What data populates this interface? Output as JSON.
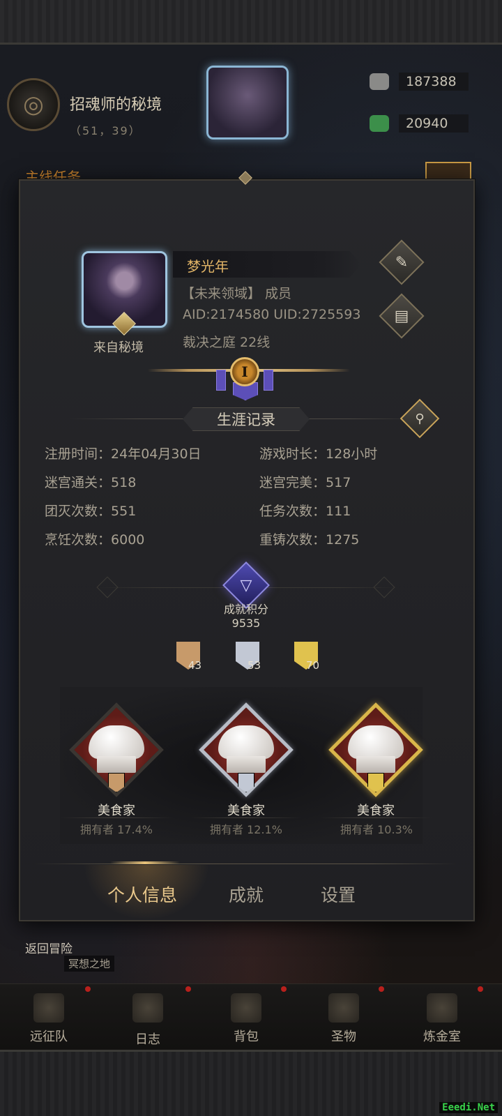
{
  "background": {
    "map_name": "招魂师的秘境",
    "map_coord": "（51，39）",
    "resources": [
      {
        "icon": "grey-stone-icon",
        "value": "187388",
        "color": "#8a8a88"
      },
      {
        "icon": "green-crystal-icon",
        "value": "20940",
        "color": "#3c8f4a"
      }
    ],
    "quest_label": "主线任务"
  },
  "profile": {
    "avatar_caption": "来自秘境",
    "name": "梦光年",
    "guild": "【未来领域】 成员",
    "ids": "AID:2174580  UID:2725593",
    "server": "裁决之庭 22线",
    "rank_numeral": "I"
  },
  "career": {
    "title": "生涯记录",
    "stats": [
      {
        "label": "注册时间：",
        "value": "24年04月30日"
      },
      {
        "label": "游戏时长：",
        "value": "128小时"
      },
      {
        "label": "迷宫通关：",
        "value": "518"
      },
      {
        "label": "迷宫完美：",
        "value": "517"
      },
      {
        "label": "团灭次数：",
        "value": "551"
      },
      {
        "label": "任务次数：",
        "value": "111"
      },
      {
        "label": "烹饪次数：",
        "value": "6000"
      },
      {
        "label": "重铸次数：",
        "value": "1275"
      }
    ]
  },
  "achievements": {
    "label": "成就积分",
    "score": "9535",
    "tiers": [
      {
        "name": "bronze",
        "count": "43",
        "color": "#c79a6a"
      },
      {
        "name": "silver",
        "count": "53",
        "color": "#c2c8d4"
      },
      {
        "name": "gold",
        "count": "70",
        "color": "#e0c24e"
      }
    ],
    "cards": [
      {
        "title": "美食家",
        "owners": "拥有者 17.4%",
        "tier": "bronze"
      },
      {
        "title": "美食家",
        "owners": "拥有者 12.1%",
        "tier": "silver"
      },
      {
        "title": "美食家",
        "owners": "拥有者 10.3%",
        "tier": "gold"
      }
    ]
  },
  "tabs": [
    {
      "label": "个人信息",
      "active": true
    },
    {
      "label": "成就",
      "active": false
    },
    {
      "label": "设置",
      "active": false
    }
  ],
  "footer": {
    "return_label": "返回冒险",
    "sub_label": "冥想之地"
  },
  "bottom_nav": [
    {
      "label": "远征队",
      "icon": "horned-helmet-icon"
    },
    {
      "label": "日志",
      "icon": "journal-icon"
    },
    {
      "label": "背包",
      "icon": "backpack-icon"
    },
    {
      "label": "圣物",
      "icon": "chalice-icon"
    },
    {
      "label": "炼金室",
      "icon": "alchemy-icon"
    }
  ],
  "watermark": "Eeedi.Net"
}
